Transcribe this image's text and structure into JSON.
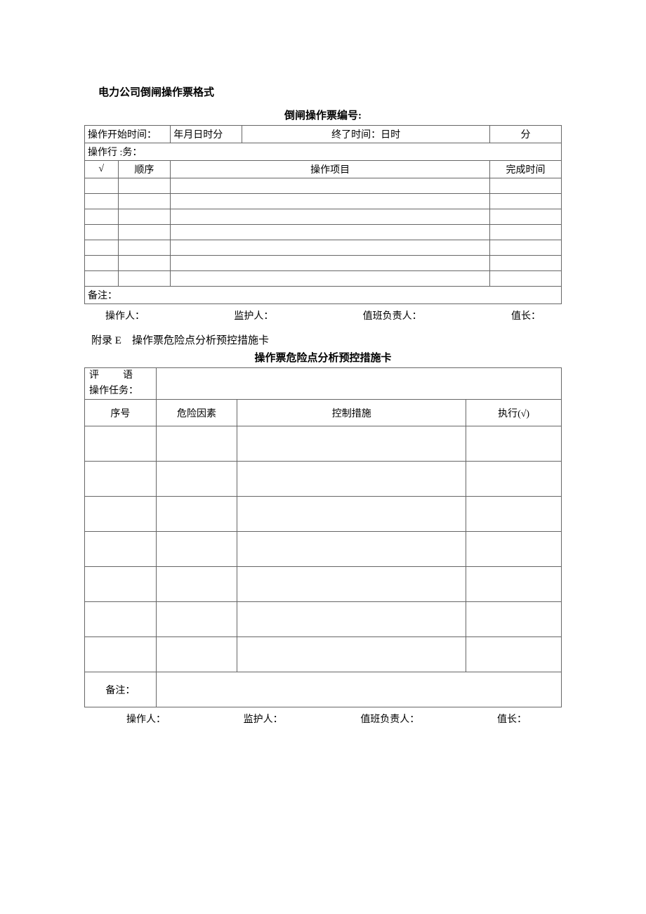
{
  "doc": {
    "title": "电力公司倒闸操作票格式",
    "form_number_label": "倒闸操作票编号:"
  },
  "table1": {
    "time_line": {
      "start_label": "操作开始时间：",
      "start_fields": "年月日时分",
      "end_label": "终了时间：日时",
      "minute_label": "分"
    },
    "task_label": "操作行 :务：",
    "headers": {
      "check": "√",
      "seq": "顺序",
      "item": "操作项目",
      "done": "完成时间"
    },
    "note_label": "备注："
  },
  "sig1": {
    "operator": "操作人：",
    "supervisor": "监护人：",
    "duty_chief": "值班负责人：",
    "shift_leader": "值长："
  },
  "appendix": {
    "label_prefix": "附录",
    "label_letter": "E",
    "title": "操作票危险点分析预控措施卡"
  },
  "card": {
    "title": "操作票危险点分析预控措施卡",
    "comment_label": "评　语",
    "task_label": "操作任务：",
    "headers": {
      "seq": "序号",
      "risk": "危险因素",
      "control": "控制措施",
      "exec": "执行(√)"
    },
    "note_label": "备注："
  },
  "sig2": {
    "operator": "操作人：",
    "supervisor": "监护人：",
    "duty_chief": "值班负责人：",
    "shift_leader": "值长："
  }
}
